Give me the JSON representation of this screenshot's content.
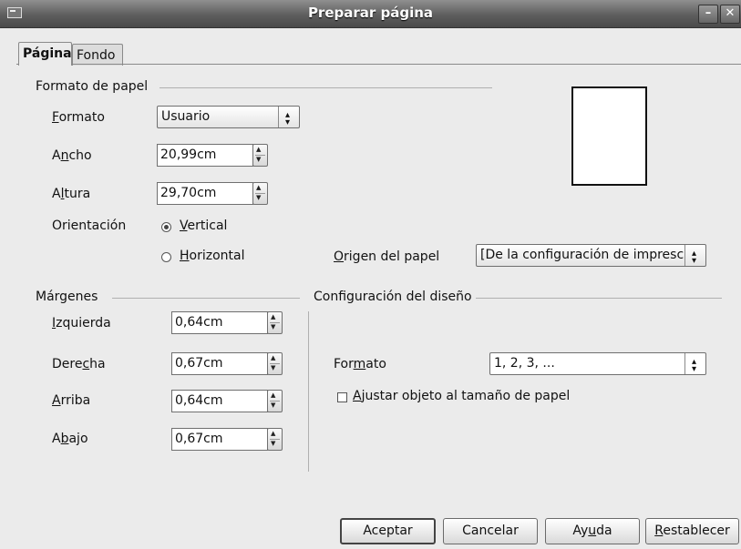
{
  "window": {
    "title": "Preparar página"
  },
  "tabs": [
    {
      "label": "Página"
    },
    {
      "label": "Fondo"
    }
  ],
  "paper": {
    "section": "Formato de papel",
    "format_label_pre": "",
    "format_label_u": "F",
    "format_label_post": "ormato",
    "format_value": "Usuario",
    "width_label_pre": "A",
    "width_label_u": "n",
    "width_label_post": "cho",
    "width_value": "20,99cm",
    "height_label_pre": "A",
    "height_label_u": "l",
    "height_label_post": "tura",
    "height_value": "29,70cm",
    "orientation_label": "Orientación",
    "vertical_u": "V",
    "vertical_post": "ertical",
    "horizontal_u": "H",
    "horizontal_post": "orizontal",
    "orientation_selected": "Vertical",
    "source_label_u": "O",
    "source_label_post": "rigen del papel",
    "source_value": "[De la configuración de impresc"
  },
  "margins": {
    "section": "Márgenes",
    "left_u": "I",
    "left_post": "zquierda",
    "left_value": "0,64cm",
    "right_pre": "Dere",
    "right_u": "c",
    "right_post": "ha",
    "right_value": "0,67cm",
    "top_u": "A",
    "top_post": "rriba",
    "top_value": "0,64cm",
    "bottom_pre": "A",
    "bottom_u": "b",
    "bottom_post": "ajo",
    "bottom_value": "0,67cm"
  },
  "layout": {
    "section": "Configuración del diseño",
    "format_pre": "For",
    "format_u": "m",
    "format_post": "ato",
    "format_value": "1, 2, 3, ...",
    "fit_u": "A",
    "fit_post": "justar objeto al tamaño de papel"
  },
  "buttons": {
    "ok": "Aceptar",
    "cancel": "Cancelar",
    "help_pre": "Ay",
    "help_u": "u",
    "help_post": "da",
    "reset_u": "R",
    "reset_post": "establecer"
  }
}
